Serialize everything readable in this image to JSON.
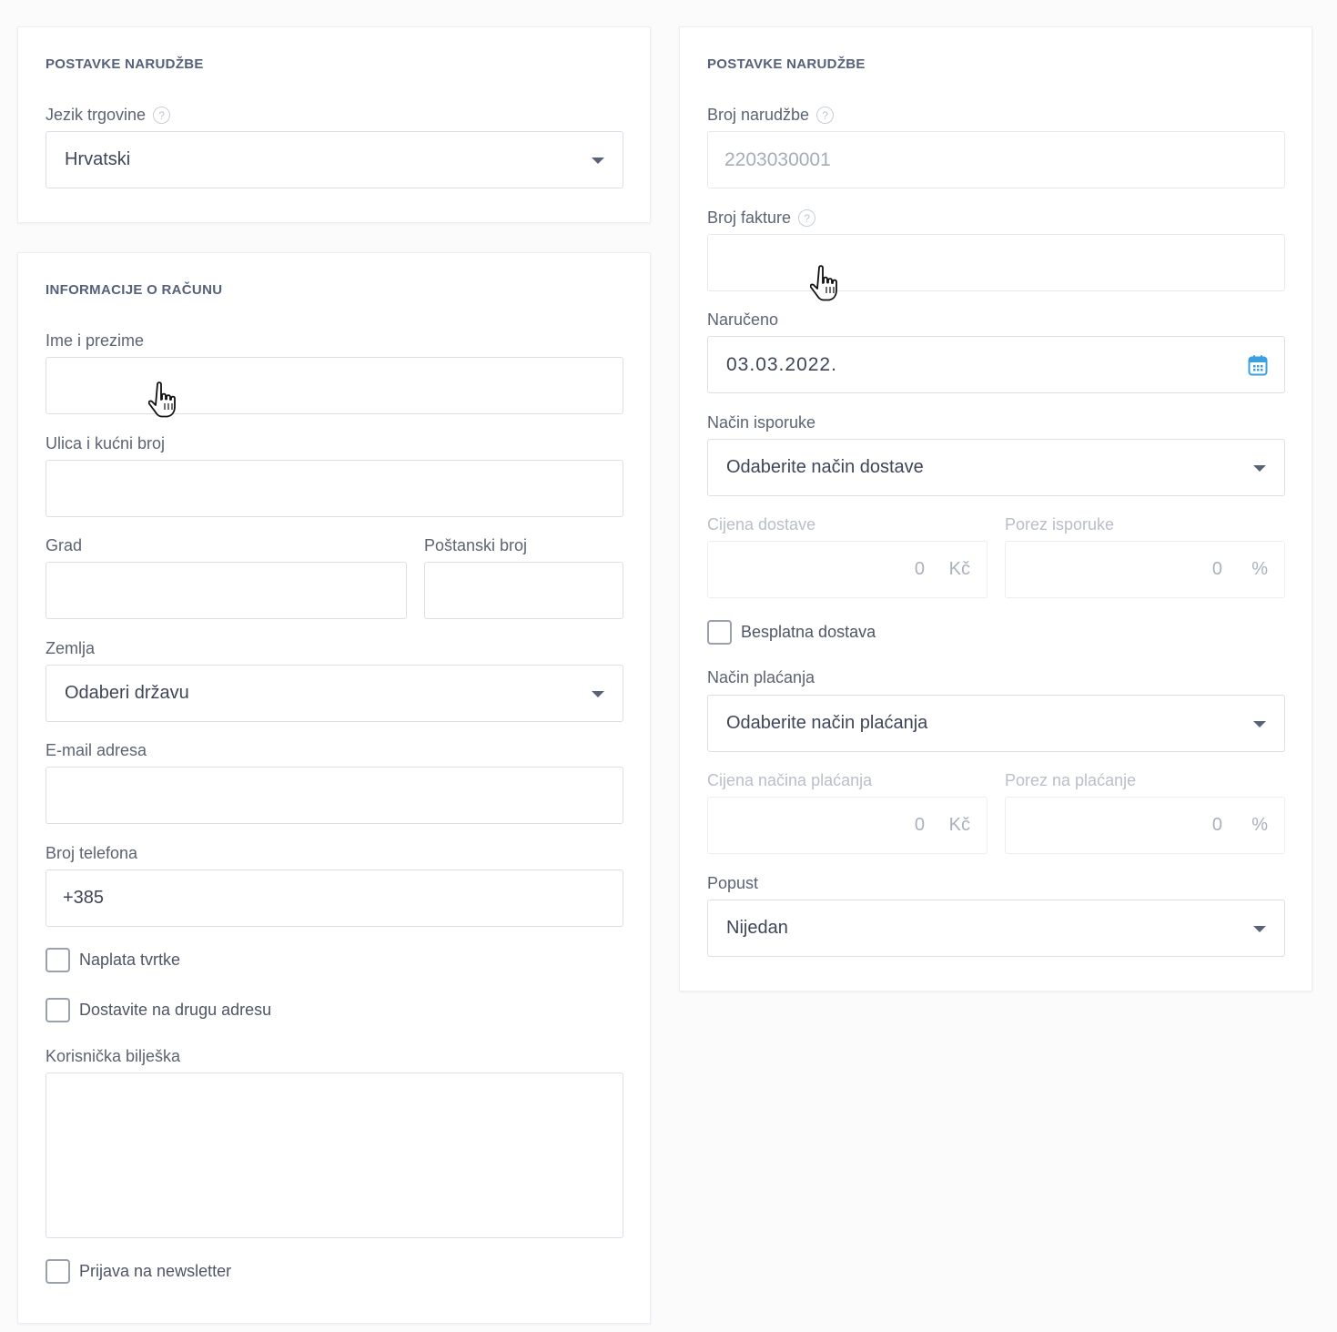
{
  "order_settings_left": {
    "title": "POSTAVKE NARUDŽBE",
    "language_label": "Jezik trgovine",
    "language_value": "Hrvatski"
  },
  "billing": {
    "title": "INFORMACIJE O RAČUNU",
    "name_label": "Ime i prezime",
    "name_value": "",
    "street_label": "Ulica i kućni broj",
    "street_value": "",
    "city_label": "Grad",
    "city_value": "",
    "zip_label": "Poštanski broj",
    "zip_value": "",
    "country_label": "Zemlja",
    "country_value": "Odaberi državu",
    "email_label": "E-mail adresa",
    "email_value": "",
    "phone_label": "Broj telefona",
    "phone_value": "+385",
    "company_billing_label": "Naplata tvrtke",
    "company_billing_checked": false,
    "other_address_label": "Dostavite na drugu adresu",
    "other_address_checked": false,
    "note_label": "Korisnička bilješka",
    "note_value": "",
    "newsletter_label": "Prijava na newsletter",
    "newsletter_checked": false
  },
  "order_settings_right": {
    "title": "POSTAVKE NARUDŽBE",
    "order_number_label": "Broj narudžbe",
    "order_number_value": "2203030001",
    "invoice_number_label": "Broj fakture",
    "invoice_number_value": "",
    "ordered_label": "Naručeno",
    "ordered_value": "03.03.2022.",
    "delivery_method_label": "Način isporuke",
    "delivery_method_value": "Odaberite način dostave",
    "delivery_price_label": "Cijena dostave",
    "delivery_price_value": "0",
    "delivery_price_unit": "Kč",
    "delivery_tax_label": "Porez isporuke",
    "delivery_tax_value": "0",
    "delivery_tax_unit": "%",
    "free_delivery_label": "Besplatna dostava",
    "free_delivery_checked": false,
    "payment_method_label": "Način plaćanja",
    "payment_method_value": "Odaberite način plaćanja",
    "payment_price_label": "Cijena načina plaćanja",
    "payment_price_value": "0",
    "payment_price_unit": "Kč",
    "payment_tax_label": "Porez na plaćanje",
    "payment_tax_value": "0",
    "payment_tax_unit": "%",
    "discount_label": "Popust",
    "discount_value": "Nijedan"
  },
  "icons": {
    "help": "?",
    "dropdown": "caret-down-icon",
    "calendar": "calendar-icon",
    "pointer": "hand-pointer-cursor"
  },
  "colors": {
    "accent": "#3aa0e0",
    "title": "#56607a",
    "border": "#dcdfe6"
  }
}
